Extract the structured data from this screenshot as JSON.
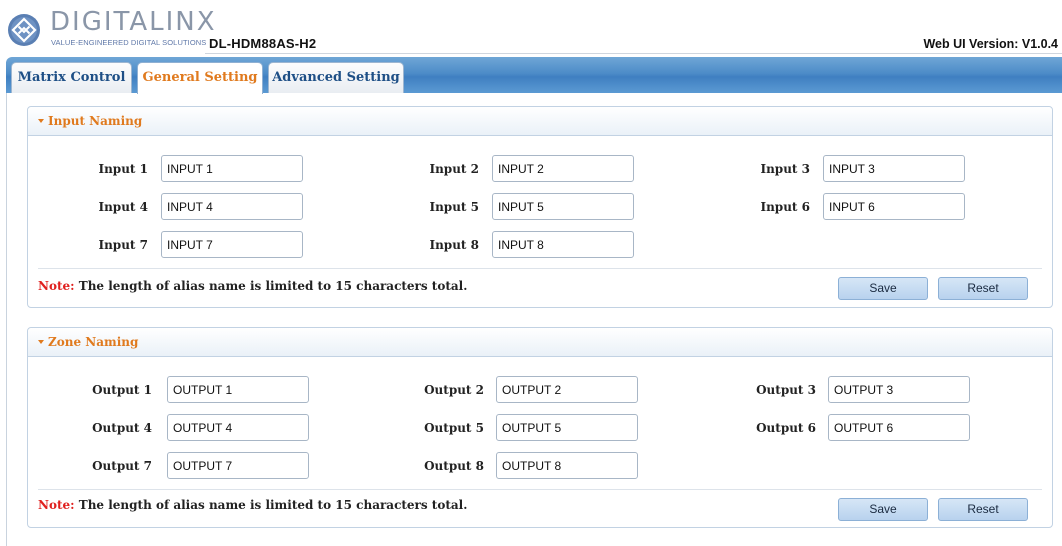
{
  "header": {
    "brand_name": "DIGITALINX",
    "brand_tagline": "VALUE-ENGINEERED DIGITAL SOLUTIONS",
    "model": "DL-HDM88AS-H2",
    "version": "Web UI Version: V1.0.4",
    "logo_icon": "diamond-logo-icon"
  },
  "tabs": [
    {
      "label": "Matrix Control",
      "active": false
    },
    {
      "label": "General Setting",
      "active": true
    },
    {
      "label": "Advanced Setting",
      "active": false
    }
  ],
  "input_naming": {
    "title": "Input Naming",
    "fields": [
      {
        "label": "Input 1",
        "value": "INPUT 1"
      },
      {
        "label": "Input 2",
        "value": "INPUT 2"
      },
      {
        "label": "Input 3",
        "value": "INPUT 3"
      },
      {
        "label": "Input 4",
        "value": "INPUT 4"
      },
      {
        "label": "Input 5",
        "value": "INPUT 5"
      },
      {
        "label": "Input 6",
        "value": "INPUT 6"
      },
      {
        "label": "Input 7",
        "value": "INPUT 7"
      },
      {
        "label": "Input 8",
        "value": "INPUT 8"
      }
    ],
    "note_key": "Note:",
    "note_text": " The length of alias name is limited to 15 characters total.",
    "save_label": "Save",
    "reset_label": "Reset"
  },
  "zone_naming": {
    "title": "Zone Naming",
    "fields": [
      {
        "label": "Output 1",
        "value": "OUTPUT 1"
      },
      {
        "label": "Output 2",
        "value": "OUTPUT 2"
      },
      {
        "label": "Output 3",
        "value": "OUTPUT 3"
      },
      {
        "label": "Output 4",
        "value": "OUTPUT 4"
      },
      {
        "label": "Output 5",
        "value": "OUTPUT 5"
      },
      {
        "label": "Output 6",
        "value": "OUTPUT 6"
      },
      {
        "label": "Output 7",
        "value": "OUTPUT 7"
      },
      {
        "label": "Output 8",
        "value": "OUTPUT 8"
      }
    ],
    "note_key": "Note:",
    "note_text": " The length of alias name is limited to 15 characters total.",
    "save_label": "Save",
    "reset_label": "Reset"
  },
  "colors": {
    "accent_orange": "#e07a1e",
    "tab_blue": "#4d8cc8",
    "note_red": "#e0201e",
    "link_blue": "#1e4f86"
  }
}
